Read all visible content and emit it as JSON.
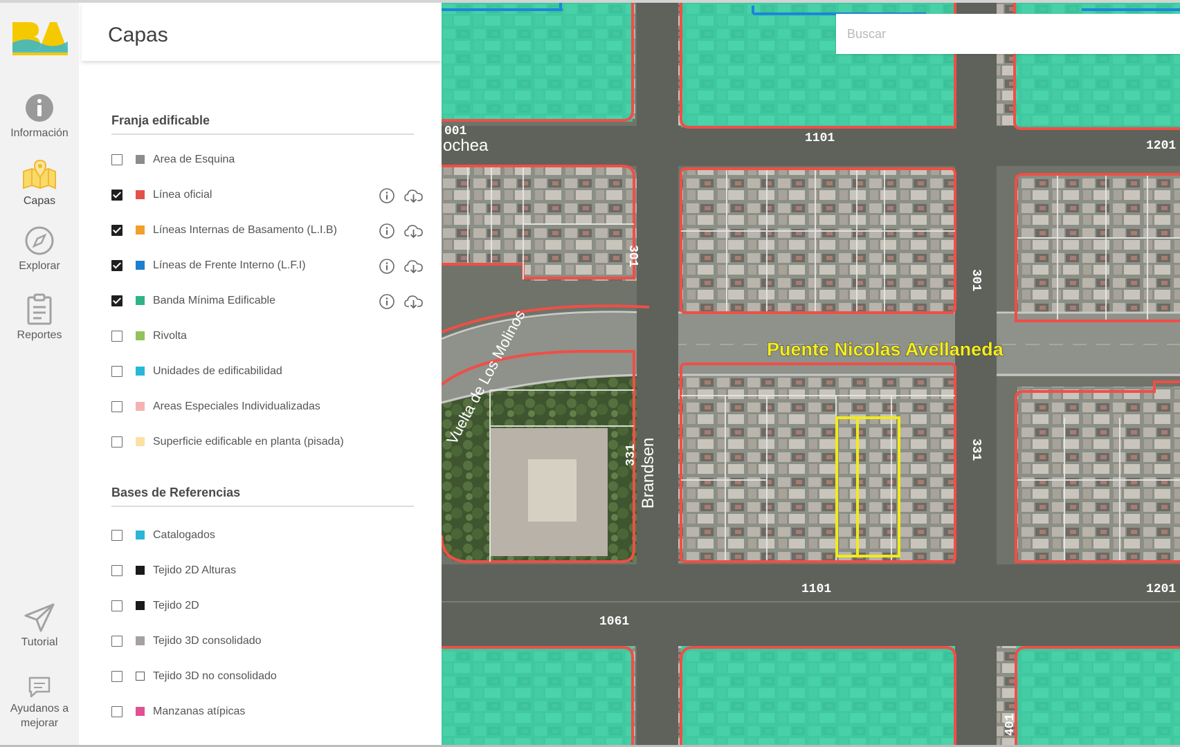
{
  "app": {
    "logo_text": "BA",
    "brand_color": "#f5c900",
    "accent_color": "#35b6cc"
  },
  "nav": {
    "items": [
      {
        "label": "Información",
        "icon": "info-icon"
      },
      {
        "label": "Capas",
        "icon": "map-layers-icon",
        "active": true
      },
      {
        "label": "Explorar",
        "icon": "compass-icon"
      },
      {
        "label": "Reportes",
        "icon": "clipboard-icon"
      },
      {
        "label": "Tutorial",
        "icon": "paper-plane-icon"
      },
      {
        "label_line1": "Ayudanos a",
        "label_line2": "mejorar",
        "icon": "feedback-icon"
      }
    ]
  },
  "panel": {
    "title": "Capas",
    "sections": [
      {
        "title": "Franja edificable",
        "items": [
          {
            "label": "Area de Esquina",
            "checked": false,
            "color": "#8c8c8c",
            "actions": false
          },
          {
            "label": "Línea oficial",
            "checked": true,
            "color": "#e2514a",
            "actions": true
          },
          {
            "label": "Líneas Internas de Basamento (L.I.B)",
            "checked": true,
            "color": "#f0a12c",
            "actions": true
          },
          {
            "label": "Líneas de Frente Interno (L.F.I)",
            "checked": true,
            "color": "#1c7fcf",
            "actions": true
          },
          {
            "label": "Banda Mínima Edificable",
            "checked": true,
            "color": "#2fb48a",
            "actions": true
          },
          {
            "label": "Rivolta",
            "checked": false,
            "color": "#92c25a",
            "actions": false
          },
          {
            "label": "Unidades de edificabilidad",
            "checked": false,
            "color": "#27b8d8",
            "actions": false
          },
          {
            "label": "Areas Especiales Individualizadas",
            "checked": false,
            "color": "#f4b3b0",
            "actions": false
          },
          {
            "label": "Superficie edificable en planta (pisada)",
            "checked": false,
            "color": "#fbe1a3",
            "actions": false
          }
        ]
      },
      {
        "title": "Bases de Referencias",
        "items": [
          {
            "label": "Catalogados",
            "checked": false,
            "color": "#2bb6d9",
            "actions": false
          },
          {
            "label": "Tejido 2D Alturas",
            "checked": false,
            "color": "#1a1a1a",
            "actions": false
          },
          {
            "label": "Tejido 2D",
            "checked": false,
            "color": "#1a1a1a",
            "actions": false
          },
          {
            "label": "Tejido 3D consolidado",
            "checked": false,
            "color": "#a7a0a0",
            "actions": false
          },
          {
            "label": "Tejido 3D no consolidado",
            "checked": false,
            "color": "#ffffff",
            "actions": false
          },
          {
            "label": "Manzanas atípicas",
            "checked": false,
            "color": "#e24f93",
            "actions": false
          }
        ]
      }
    ],
    "action_icons": {
      "info": "info-circle-icon",
      "download": "cloud-download-icon"
    }
  },
  "map": {
    "search_placeholder": "Buscar",
    "labels": {
      "bridge": "Puente Nicolas Avellaneda",
      "street_brandsen": "Brandsen",
      "street_ochea": "ochea",
      "street_curved": "Vuelta de Los Molinos",
      "num_001": "001",
      "num_1101_top": "1101",
      "num_1201_top": "1201",
      "num_301_left": "301",
      "num_301_mid": "301",
      "num_331_left": "331",
      "num_331_mid": "331",
      "num_1101_bottom": "1101",
      "num_1061": "1061",
      "num_1201_bottom": "1201",
      "num_401": "401"
    },
    "colors": {
      "lot_outline": "#ef4f47",
      "zone_fill": "#2fd6a6",
      "selection": "#f2ea1d",
      "lfi_blue": "#1c86d9"
    }
  }
}
